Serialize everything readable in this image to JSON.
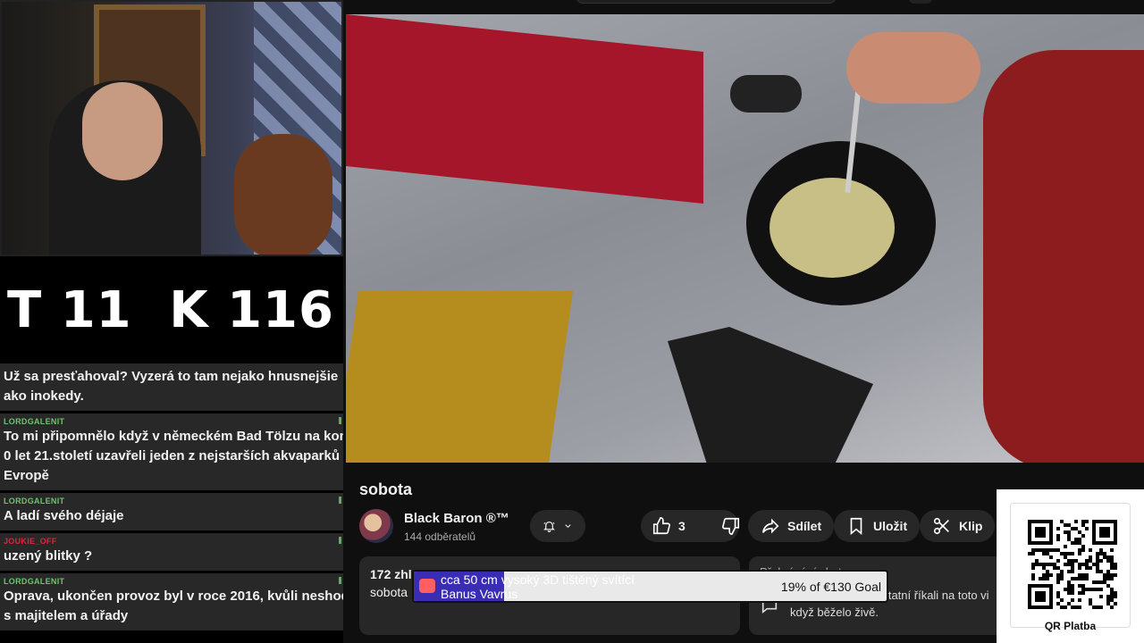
{
  "counter": {
    "t_label": "T 11",
    "k_label": "K 116"
  },
  "chat": [
    {
      "user": "",
      "text": "Už sa presťahoval? Vyzerá to tam nejako hnusnejšie",
      "text2": "ako inokedy.",
      "text3": ""
    },
    {
      "user": "LORDGALENIT",
      "text": "To mi připomnělo když v německém Bad Tölzu na konc",
      "text2": "0 let 21.století uzavřeli jeden z nejstarších akvaparků v",
      "text3": "Evropě"
    },
    {
      "user": "LORDGALENIT",
      "text": "A ladí svého déjaje",
      "text2": "",
      "text3": ""
    },
    {
      "user": "JOUKIE_OFF",
      "text": "uzený blitky ?",
      "text2": "",
      "text3": ""
    },
    {
      "user": "LORDGALENIT",
      "text": "Oprava, ukončen provoz byl v roce 2016, kvůli neshodě",
      "text2": "s majitelem a úřady",
      "text3": ""
    }
  ],
  "video": {
    "title": "sobota",
    "channel": "Black Baron ®™",
    "subscribers": "144 odběratelů",
    "likes": "3",
    "share_label": "Sdílet",
    "save_label": "Uložit",
    "clip_label": "Klip",
    "desc_views": "172 zhlé",
    "desc_text": "sobota",
    "replay_title": "Přehrávání chatu",
    "replay_desc": "Podívejte se, co ostatní říkali na toto vi když běželo živě."
  },
  "goal": {
    "title": "cca 50 cm vysoký 3D tištěný svítící",
    "name": "Banus Vavrus",
    "percent_text": "19% of €130 Goal",
    "progress": 0.19,
    "fill_color": "#3b2db3"
  },
  "qr": {
    "label": "QR Platba"
  },
  "icons": [
    "bell-icon",
    "chevron-down-icon",
    "thumbs-up-icon",
    "thumbs-down-icon",
    "share-icon",
    "bookmark-icon",
    "scissors-icon",
    "chat-icon",
    "goal-icon"
  ]
}
